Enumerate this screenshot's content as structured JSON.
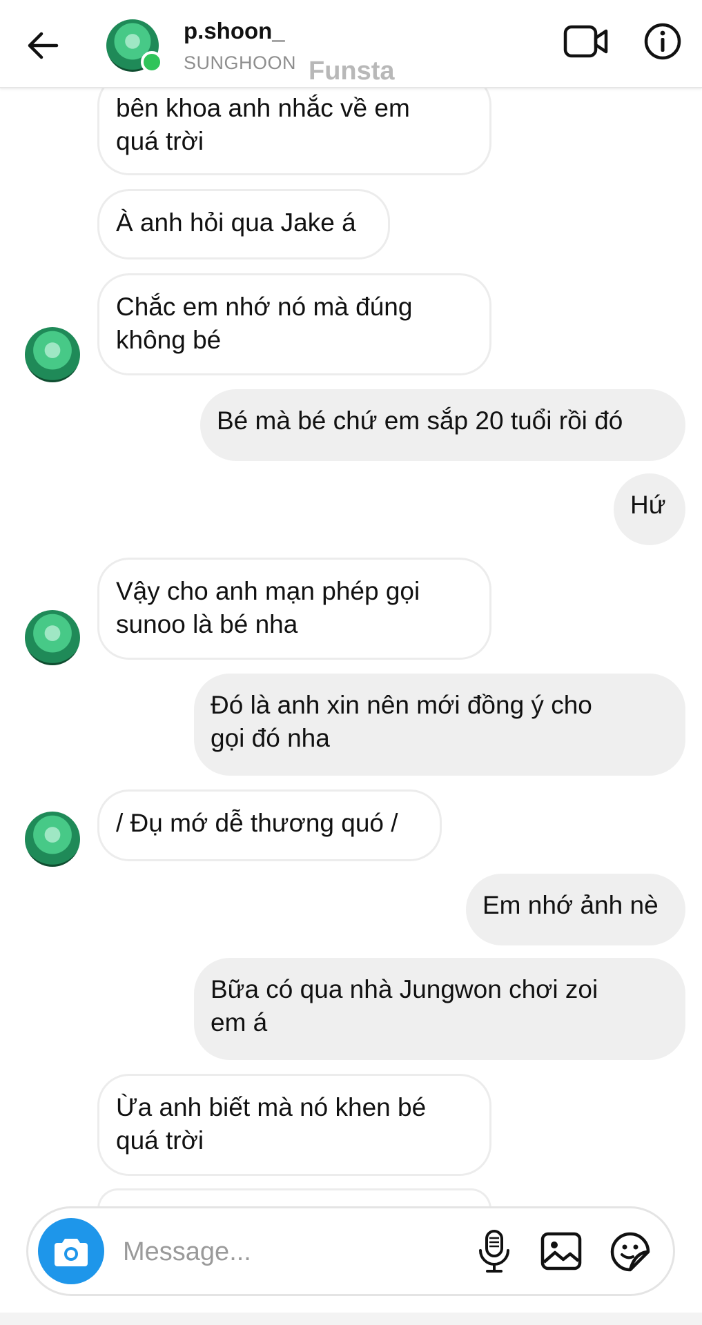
{
  "header": {
    "username": "p.shoon_",
    "display_name": "SUNGHOON",
    "watermark": "Funsta"
  },
  "icons": {
    "back": "arrow-left-icon",
    "video_call": "video-camera-icon",
    "info": "info-icon",
    "camera": "camera-icon",
    "mic": "microphone-icon",
    "gallery": "image-icon",
    "sticker": "sticker-icon"
  },
  "colors": {
    "accent": "#1e96ea",
    "online": "#2fc45a",
    "sent_bubble": "#efefef",
    "received_border": "#ececec"
  },
  "messages": [
    {
      "from": "them",
      "text": "bên khoa anh nhắc về em\nquá trời"
    },
    {
      "from": "them",
      "text": "À anh hỏi qua Jake á"
    },
    {
      "from": "them",
      "text": "Chắc em nhớ nó mà đúng\nkhông bé"
    },
    {
      "from": "me",
      "text": "Bé mà bé chứ em sắp 20 tuổi rồi đó"
    },
    {
      "from": "me",
      "text": "Hứ"
    },
    {
      "from": "them",
      "text": "Vậy cho anh mạn phép gọi\nsunoo là bé nha"
    },
    {
      "from": "me",
      "text": "Đó là anh xin nên mới đồng ý cho\ngọi đó nha"
    },
    {
      "from": "them",
      "text": "/ Đụ mớ dễ thương quó /"
    },
    {
      "from": "me",
      "text": "Em nhớ ảnh nè"
    },
    {
      "from": "me",
      "text": "Bữa có qua nhà Jungwon chơi zoi\nem á"
    },
    {
      "from": "them",
      "text": "Ừa anh biết mà nó khen bé\nquá trời"
    }
  ],
  "composer": {
    "placeholder": "Message..."
  }
}
